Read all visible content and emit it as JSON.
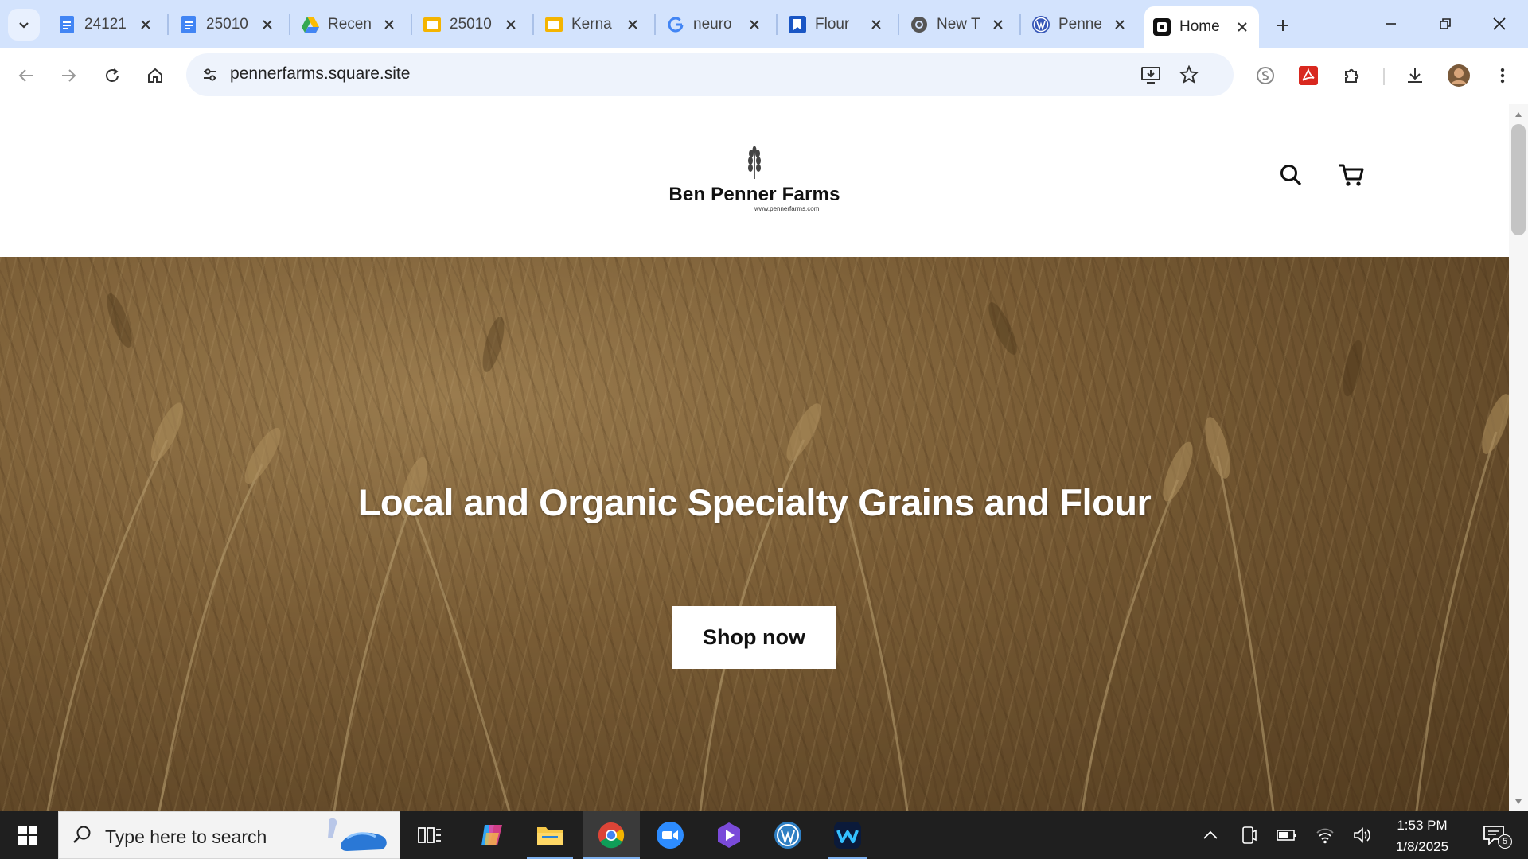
{
  "browser": {
    "tabs": [
      {
        "title": "24121",
        "favicon": "docs-icon"
      },
      {
        "title": "25010",
        "favicon": "docs-icon"
      },
      {
        "title": "Recen",
        "favicon": "drive-icon"
      },
      {
        "title": "25010",
        "favicon": "slides-icon"
      },
      {
        "title": "Kerna",
        "favicon": "slides-icon"
      },
      {
        "title": "neuro",
        "favicon": "google-icon"
      },
      {
        "title": "Flour",
        "favicon": "bookmark-app-icon"
      },
      {
        "title": "New T",
        "favicon": "chrome-icon"
      },
      {
        "title": "Penne",
        "favicon": "wordpress-icon"
      },
      {
        "title": "Home",
        "favicon": "square-icon",
        "active": true
      }
    ],
    "url": "pennerfarms.square.site"
  },
  "site": {
    "brand_name": "Ben Penner Farms",
    "brand_url": "www.pennerfarms.com",
    "hero_title": "Local and Organic Specialty Grains and Flour",
    "cta_label": "Shop now"
  },
  "taskbar": {
    "search_placeholder": "Type here to search",
    "time": "1:53 PM",
    "date": "1/8/2025",
    "notification_count": "5"
  },
  "colors": {
    "tabstrip": "#d3e3fd",
    "omnibox": "#eef3fc",
    "taskbar": "#1f1f1f",
    "hero_tone": "#8c6b3f"
  }
}
